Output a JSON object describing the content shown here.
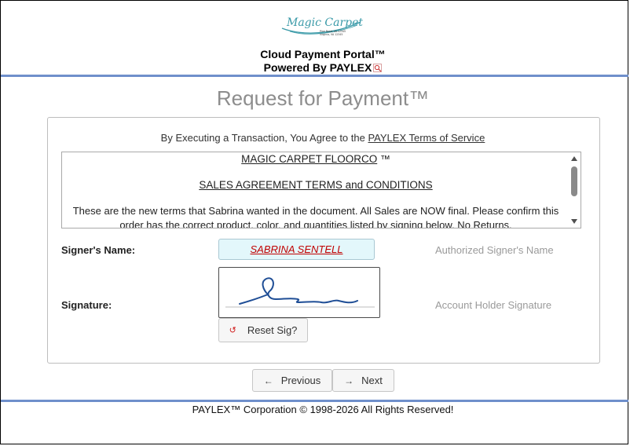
{
  "header": {
    "logo_text": "Magic Carpet",
    "logo_address_line1": "Pine Road, VA 12345",
    "logo_address_line2": "Virginia, VA 12345",
    "portal_title": "Cloud Payment Portal™",
    "powered_by": "Powered By PAYLEX",
    "powered_icon": "paylex-logo-icon"
  },
  "page": {
    "heading": "Request for Payment™"
  },
  "agreement": {
    "prefix": "By Executing a Transaction, You Agree to the ",
    "link_text": "PAYLEX Terms of Service"
  },
  "terms": {
    "company": "MAGIC CARPET FLOORCO",
    "company_mark": " ™",
    "heading": "SALES AGREEMENT TERMS and CONDITIONS",
    "body": "These are the new terms that Sabrina wanted in the document. All Sales are NOW final. Please confirm this order has the correct product, color, and quantities listed by signing below. No Returns."
  },
  "signer": {
    "label": "Signer's Name:",
    "value": "SABRINA SENTELL",
    "hint": "Authorized Signer's Name"
  },
  "signature": {
    "label": "Signature:",
    "hint": "Account Holder Signature",
    "reset_label": "Reset Sig?",
    "reset_icon": "reset-icon",
    "stroke_color": "#1f4e96"
  },
  "nav": {
    "previous_label": "Previous",
    "previous_icon": "arrow-left-icon",
    "next_label": "Next",
    "next_icon": "arrow-right-icon"
  },
  "footer": {
    "text": "PAYLEX™ Corporation © 1998-2026 All Rights Reserved!"
  },
  "colors": {
    "accent_rule": "#6f8fcb",
    "heading_gray": "#8d8d8d",
    "signer_value": "#c00000",
    "input_bg": "#e3f7fb",
    "logo_teal": "#3a9aa8"
  }
}
